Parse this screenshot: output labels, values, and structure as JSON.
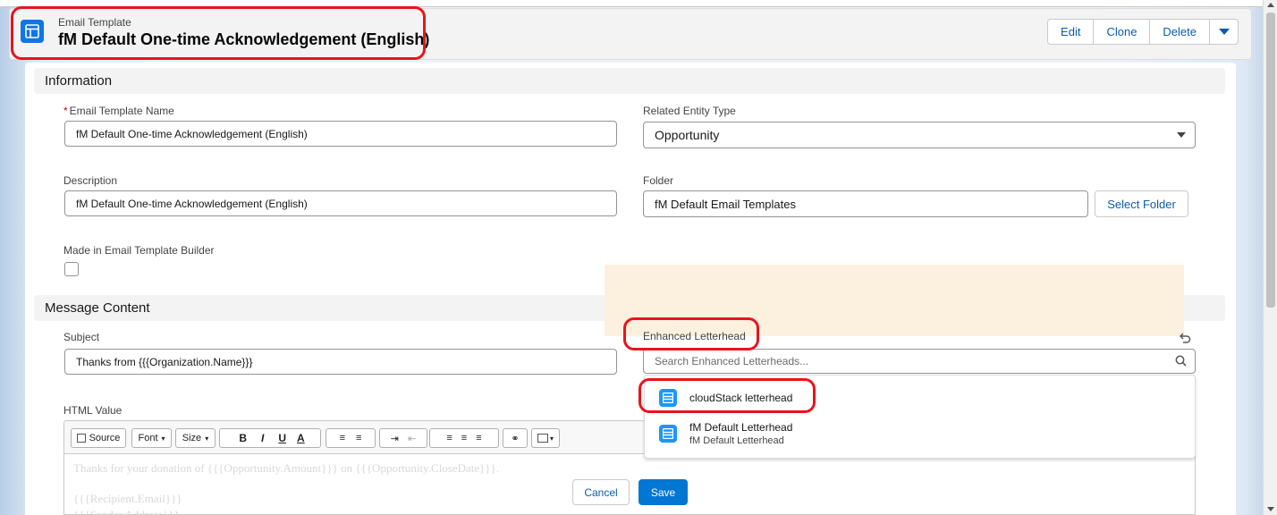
{
  "header": {
    "object_type": "Email Template",
    "title": "fM Default One-time Acknowledgement (English)",
    "buttons": {
      "edit": "Edit",
      "clone": "Clone",
      "delete": "Delete"
    }
  },
  "information": {
    "section_title": "Information",
    "template_name": {
      "label": "Email Template Name",
      "required_mark": "*",
      "value": "fM Default One-time Acknowledgement (English)"
    },
    "related_entity": {
      "label": "Related Entity Type",
      "value": "Opportunity"
    },
    "description": {
      "label": "Description",
      "value": "fM Default One-time Acknowledgement (English)"
    },
    "folder": {
      "label": "Folder",
      "value": "fM Default Email Templates",
      "select_button": "Select Folder"
    },
    "builder": {
      "label": "Made in Email Template Builder",
      "checked": false
    }
  },
  "message": {
    "section_title": "Message Content",
    "subject": {
      "label": "Subject",
      "value": "Thanks from {{{Organization.Name}}}"
    },
    "letterhead": {
      "label": "Enhanced Letterhead",
      "placeholder": "Search Enhanced Letterheads...",
      "options": [
        {
          "title": "cloudStack letterhead",
          "subtitle": ""
        },
        {
          "title": "fM Default Letterhead",
          "subtitle": "fM Default Letterhead"
        }
      ]
    },
    "html_value": {
      "label": "HTML Value",
      "toolbar": {
        "source": "Source",
        "font": "Font",
        "size": "Size",
        "bold": "B",
        "italic": "I",
        "underline": "U",
        "color": "A"
      },
      "lines": [
        "Thanks for your donation of {{{Opportunity.Amount}}} on {{{Opportunity.CloseDate}}}.",
        "{{{Recipient.Email}}}",
        "{{{Sender.Address}}}"
      ]
    }
  },
  "footer": {
    "cancel": "Cancel",
    "save": "Save"
  },
  "colors": {
    "brand": "#0176d3",
    "annotation": "#e8141c",
    "letterhead_bg": "#fcf1de"
  }
}
